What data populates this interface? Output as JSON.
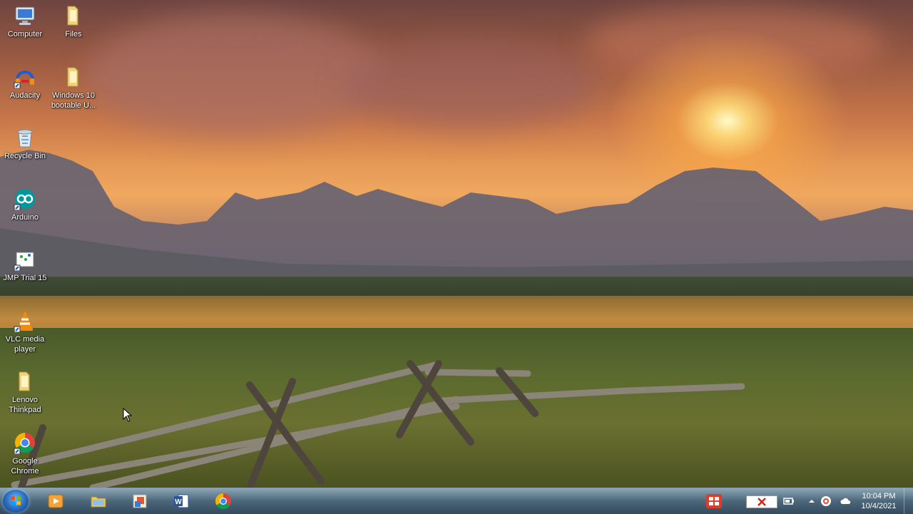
{
  "desktop_icons": [
    {
      "name": "computer",
      "label": "Computer"
    },
    {
      "name": "files",
      "label": "Files"
    },
    {
      "name": "audacity",
      "label": "Audacity"
    },
    {
      "name": "windows10-usb",
      "label": "Windows 10 bootable U..."
    },
    {
      "name": "recycle-bin",
      "label": "Recycle Bin"
    },
    {
      "name": "arduino",
      "label": "Arduino"
    },
    {
      "name": "jmp",
      "label": "JMP Trial 15"
    },
    {
      "name": "vlc",
      "label": "VLC media player"
    },
    {
      "name": "lenovo",
      "label": "Lenovo Thinkpad"
    },
    {
      "name": "chrome",
      "label": "Google Chrome"
    }
  ],
  "taskbar": {
    "apps": [
      {
        "name": "media-player",
        "icon": "media-player-icon"
      },
      {
        "name": "file-explorer",
        "icon": "folder-icon"
      },
      {
        "name": "office-tool",
        "icon": "office-icon"
      },
      {
        "name": "word",
        "icon": "word-icon"
      },
      {
        "name": "chrome",
        "icon": "chrome-icon"
      }
    ],
    "clock": {
      "time": "10:04 PM",
      "date": "10/4/2021"
    }
  },
  "colors": {
    "taskbar": "#3c5a70",
    "sun": "#fff6c8"
  }
}
